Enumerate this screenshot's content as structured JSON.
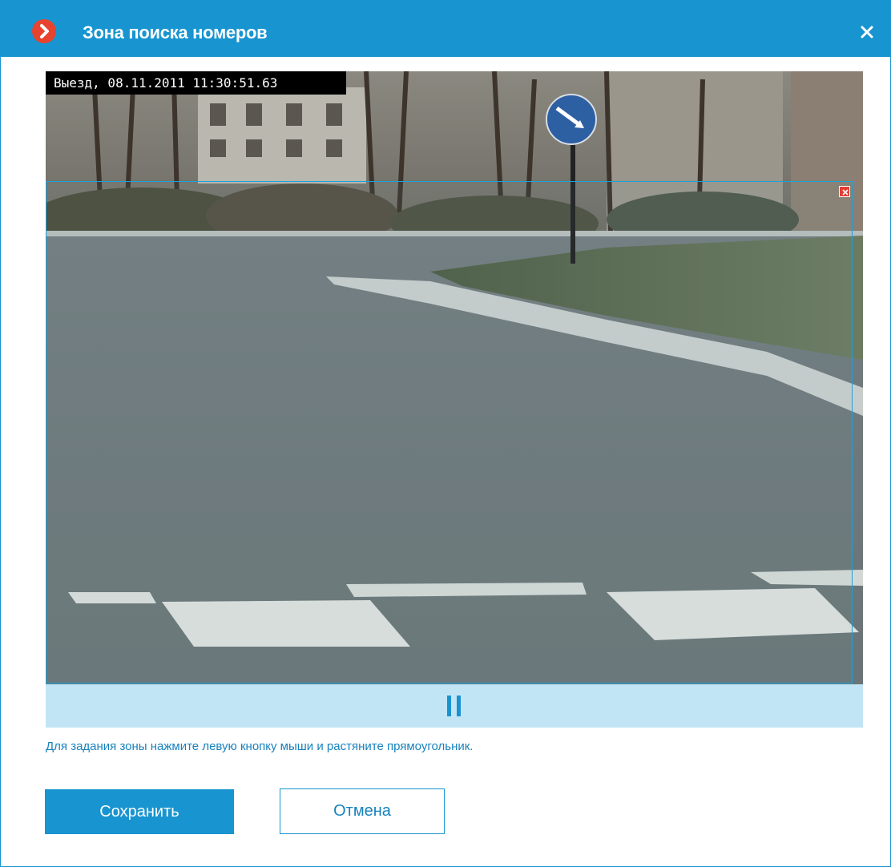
{
  "window": {
    "title": "Зона поиска номеров",
    "accent_color": "#1895d0",
    "logo_color": "#e8432f",
    "logo_icon": "chevron-right-icon",
    "close_icon": "close-icon"
  },
  "video": {
    "overlay_text": "Выезд, 08.11.2011 11:30:51.63",
    "zone_color": "#1aa2dc",
    "zone_delete_icon": "delete-zone-icon"
  },
  "controls": {
    "pause_icon": "pause-icon",
    "bar_color": "#c2e5f6"
  },
  "hint": "Для задания зоны нажмите левую кнопку мыши и растяните прямоугольник.",
  "buttons": {
    "save": "Сохранить",
    "cancel": "Отмена"
  }
}
